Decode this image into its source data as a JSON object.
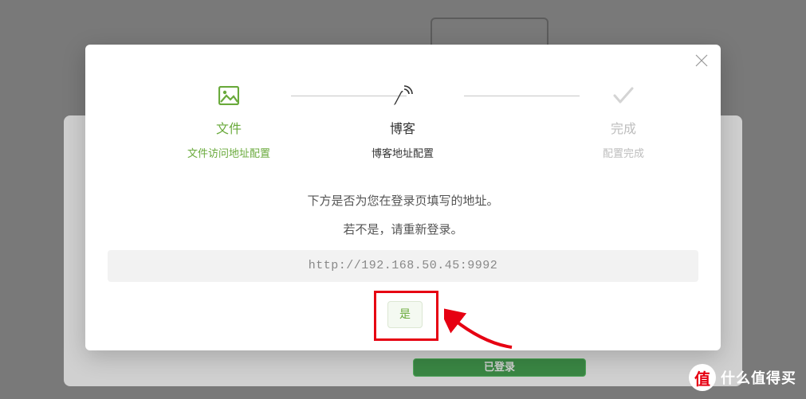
{
  "background": {
    "status_label": "已登录"
  },
  "stepper": {
    "step1": {
      "title": "文件",
      "subtitle": "文件访问地址配置"
    },
    "step2": {
      "title": "博客",
      "subtitle": "博客地址配置"
    },
    "step3": {
      "title": "完成",
      "subtitle": "配置完成"
    }
  },
  "message": {
    "line1": "下方是否为您在登录页填写的地址。",
    "line2": "若不是，请重新登录。"
  },
  "url": "http://192.168.50.45:9992",
  "button": {
    "confirm": "是"
  },
  "watermark": {
    "char": "值",
    "text": "什么值得买"
  }
}
